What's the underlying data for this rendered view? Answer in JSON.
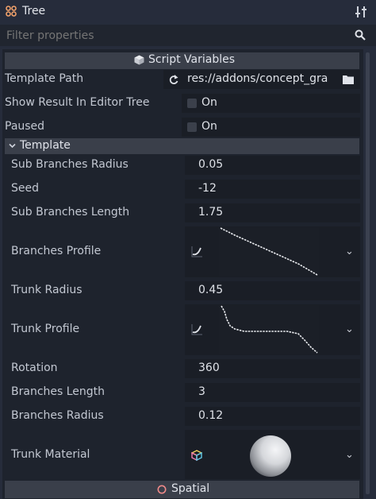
{
  "header": {
    "title": "Tree",
    "tree_icon": "tree-node-icon",
    "tools_icon": "property-tools-icon"
  },
  "filter": {
    "placeholder": "Filter properties",
    "search_icon": "search-icon"
  },
  "script_variables": {
    "label": "Script Variables",
    "icon": "script-cube-icon"
  },
  "properties": {
    "template_path": {
      "label": "Template Path",
      "value": "res://addons/concept_gra"
    },
    "show_result": {
      "label": "Show Result In Editor Tree",
      "value": "On",
      "checked": false
    },
    "paused": {
      "label": "Paused",
      "value": "On",
      "checked": false
    }
  },
  "template_section": {
    "label": "Template",
    "sub_branches_radius": {
      "label": "Sub Branches Radius",
      "value": "0.05"
    },
    "seed": {
      "label": "Seed",
      "value": "-12"
    },
    "sub_branches_length": {
      "label": "Sub Branches Length",
      "value": "1.75"
    },
    "branches_profile": {
      "label": "Branches Profile"
    },
    "trunk_radius": {
      "label": "Trunk Radius",
      "value": "0.45"
    },
    "trunk_profile": {
      "label": "Trunk Profile"
    },
    "rotation": {
      "label": "Rotation",
      "value": "360"
    },
    "branches_length": {
      "label": "Branches Length",
      "value": "3"
    },
    "branches_radius": {
      "label": "Branches Radius",
      "value": "0.12"
    },
    "trunk_material": {
      "label": "Trunk Material"
    }
  },
  "spatial": {
    "label": "Spatial",
    "icon": "spatial-node-icon"
  },
  "colors": {
    "background": "#262c3b",
    "panel": "#1e232d",
    "section_header": "#3a3f4a",
    "field": "#1a1e26",
    "spatial_icon": "#f08a8a"
  }
}
